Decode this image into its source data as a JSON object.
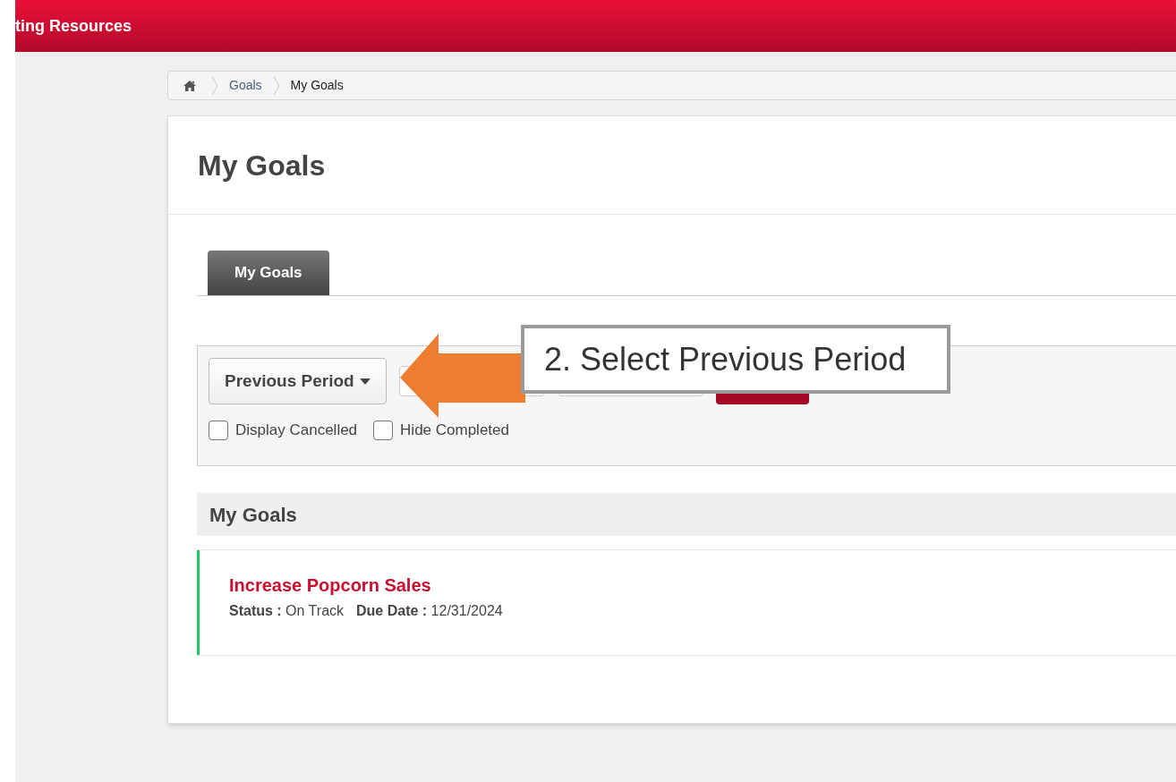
{
  "header": {
    "title": "ting Resources"
  },
  "breadcrumb": [
    {
      "label": "Goals",
      "kind": "link"
    },
    {
      "label": "My Goals",
      "kind": "current"
    }
  ],
  "page_title": "My Goals",
  "tabs": [
    {
      "label": "My Goals",
      "selected": true
    }
  ],
  "filters": {
    "period_button": "Previous Period",
    "checkboxes": [
      {
        "label": "Display Cancelled",
        "checked": false
      },
      {
        "label": "Hide Completed",
        "checked": false
      }
    ]
  },
  "section_title": "My Goals",
  "goals": [
    {
      "title": "Increase Popcorn Sales",
      "color": "#22c55e",
      "status": "**Status :** On Track",
      "due_date": "**Due Date :** 12/31/2024"
    }
  ],
  "callout": {
    "text": "2. Select Previous Period"
  }
}
